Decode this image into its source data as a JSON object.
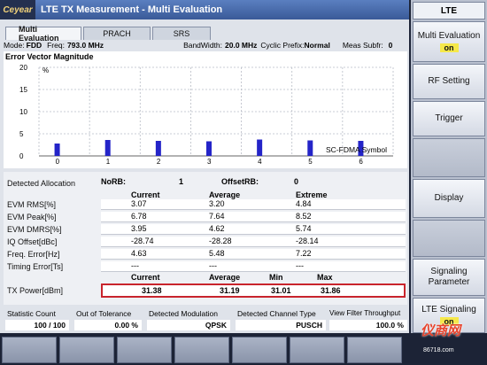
{
  "app": {
    "brand": "Ceyear",
    "title": "LTE TX Measurement - Multi Evaluation"
  },
  "tabs": [
    {
      "label": "Multi Evaluation",
      "active": true
    },
    {
      "label": "PRACH",
      "active": false
    },
    {
      "label": "SRS",
      "active": false
    }
  ],
  "info": {
    "mode_label": "Mode:",
    "mode_value": "FDD",
    "freq_label": "Freq:",
    "freq_value": "793.0 MHz",
    "bw_label": "BandWidth:",
    "bw_value": "20.0 MHz",
    "cp_label": "Cyclic Prefix:",
    "cp_value": "Normal",
    "meas_label": "Meas Subfr:",
    "meas_value": "0"
  },
  "chart_data": {
    "type": "bar",
    "title": "Error Vector Magnitude",
    "ylabel": "%",
    "xlabel": "SC-FDMA Symbol",
    "ylim": [
      0,
      20
    ],
    "yticks": [
      0,
      5,
      10,
      15,
      20
    ],
    "categories": [
      "0",
      "1",
      "2",
      "3",
      "4",
      "5",
      "6"
    ],
    "values": [
      2.8,
      3.6,
      3.4,
      3.3,
      3.7,
      3.5,
      3.4
    ],
    "bar_color": "#2424c8",
    "grid": true
  },
  "allocation": {
    "label": "Detected Allocation",
    "norb_label": "NoRB:",
    "norb_value": "1",
    "offsetrb_label": "OffsetRB:",
    "offsetrb_value": "0"
  },
  "results": {
    "headers": {
      "current": "Current",
      "average": "Average",
      "extreme": "Extreme"
    },
    "rows": [
      {
        "label": "EVM RMS[%]",
        "current": "3.07",
        "average": "3.20",
        "extreme": "4.84"
      },
      {
        "label": "EVM Peak[%]",
        "current": "6.78",
        "average": "7.64",
        "extreme": "8.52"
      },
      {
        "label": "EVM DMRS[%]",
        "current": "3.95",
        "average": "4.62",
        "extreme": "5.74"
      },
      {
        "label": "IQ Offset[dBc]",
        "current": "-28.74",
        "average": "-28.28",
        "extreme": "-28.14"
      },
      {
        "label": "Freq. Error[Hz]",
        "current": "4.63",
        "average": "5.48",
        "extreme": "7.22"
      },
      {
        "label": "Timing Error[Ts]",
        "current": "---",
        "average": "---",
        "extreme": "---"
      }
    ],
    "txpower": {
      "label": "TX Power[dBm]",
      "h_current": "Current",
      "h_average": "Average",
      "h_min": "Min",
      "h_max": "Max",
      "current": "31.38",
      "average": "31.19",
      "min": "31.01",
      "max": "31.86"
    }
  },
  "status": {
    "statistic_label": "Statistic Count",
    "statistic_value": "100 / 100",
    "tolerance_label": "Out of Tolerance",
    "tolerance_value": "0.00 %",
    "modulation_label": "Detected Modulation",
    "modulation_value": "QPSK",
    "channel_label": "Detected Channel Type",
    "channel_value": "PUSCH",
    "filter_label": "View Filter Throughput",
    "filter_value": "100.0 %"
  },
  "softkeys": {
    "header": "LTE",
    "multi_eval_label": "Multi Evaluation",
    "multi_eval_state": "on",
    "rf_setting": "RF Setting",
    "trigger": "Trigger",
    "display": "Display",
    "signaling_parameter": "Signaling Parameter",
    "lte_signaling_label": "LTE Signaling",
    "lte_signaling_state": "on"
  },
  "watermark": {
    "text": "仪商网",
    "url": "86718.com"
  }
}
